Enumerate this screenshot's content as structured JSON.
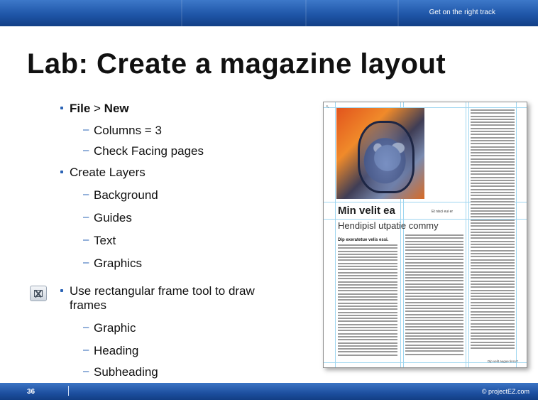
{
  "header": {
    "tagline": "Get on the right track"
  },
  "slide": {
    "title": "Lab: Create a magazine layout"
  },
  "outline": {
    "file_bold": "File",
    "file_sep": " > ",
    "new_bold": "New",
    "columns": "Columns = 3",
    "facing": "Check Facing pages",
    "create_layers": "Create Layers",
    "layer_background": "Background",
    "layer_guides": "Guides",
    "layer_text": "Text",
    "layer_graphics": "Graphics",
    "frame_tool_line1": "Use rectangular frame tool to draw",
    "frame_tool_line2": "frames",
    "frame_graphic": "Graphic",
    "frame_heading": "Heading",
    "frame_subheading": "Subheading"
  },
  "magazine": {
    "headline": "Min velit ea",
    "note": "Et nisci eui er",
    "subheadline": "Hendipisl utpatie commy",
    "section_head": "Dip exeratetue velis essi.",
    "caption": "Dip velit augue tincu?"
  },
  "footer": {
    "page_number": "36",
    "copyright": "© projectEZ.com"
  },
  "icons": {
    "frame_tool": "rectangle-frame-tool-icon"
  },
  "colors": {
    "accent": "#2a63b5",
    "bar_dark": "#123f86",
    "bar_light": "#3d78c9",
    "guide": "#9fd6f0"
  }
}
